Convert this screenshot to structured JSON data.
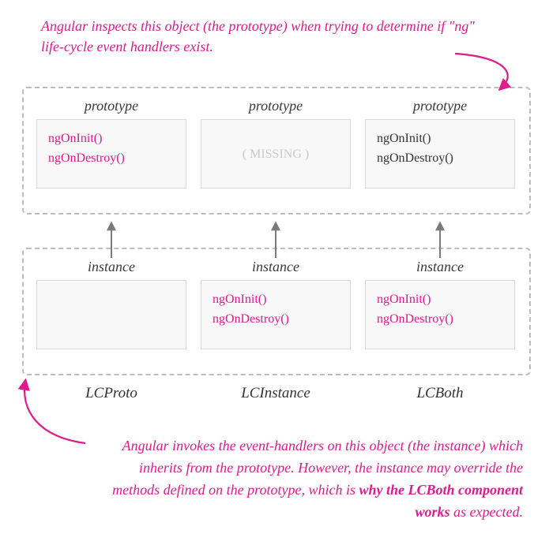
{
  "colors": {
    "accent": "#e11a8d",
    "muted": "#c9c9c9",
    "border": "#bdbdbd"
  },
  "annotation_top": "Angular inspects this object (the prototype) when trying to determine if \"ng\" life-cycle event handlers exist.",
  "annotation_bottom_pre": "Angular invokes the event-handlers on this object (the instance) which inherits from the prototype. However, the instance may override the methods defined on the prototype, which is ",
  "annotation_bottom_bold": "why the LCBoth component works",
  "annotation_bottom_post": " as expected.",
  "topRow": {
    "title": "prototype",
    "cells": [
      {
        "lines": [
          "ngOnInit()",
          "ngOnDestroy()"
        ],
        "missing": false
      },
      {
        "lines": [
          "( MISSING )"
        ],
        "missing": true
      },
      {
        "lines": [
          "ngOnInit()",
          "ngOnDestroy()"
        ],
        "missing": false
      }
    ]
  },
  "botRow": {
    "title": "instance",
    "cells": [
      {
        "lines": [],
        "missing": false
      },
      {
        "lines": [
          "ngOnInit()",
          "ngOnDestroy()"
        ],
        "missing": false
      },
      {
        "lines": [
          "ngOnInit()",
          "ngOnDestroy()"
        ],
        "missing": false
      }
    ]
  },
  "columns": [
    "LCProto",
    "LCInstance",
    "LCBoth"
  ]
}
